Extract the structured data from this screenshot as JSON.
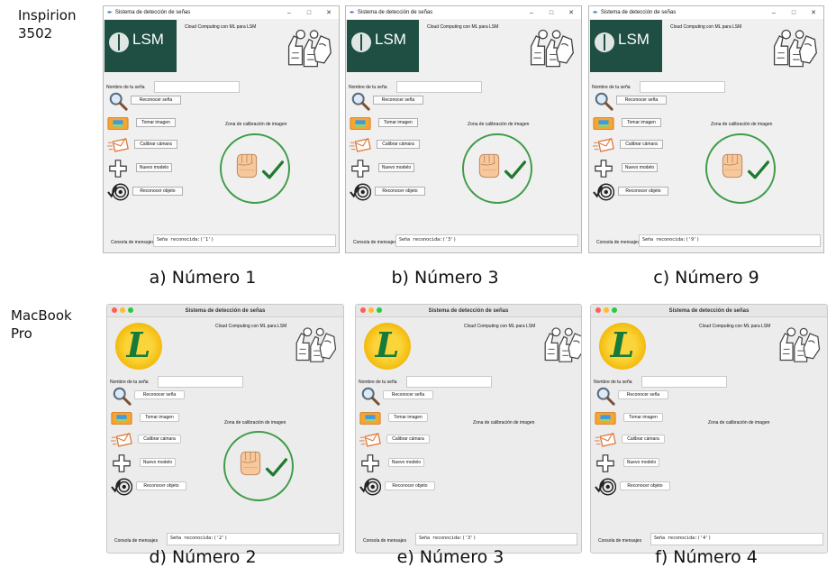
{
  "rows": [
    {
      "label": "Inspirion\n3502"
    },
    {
      "label": "MacBook\nPro"
    }
  ],
  "app": {
    "window_title": "Sistema de detección de señas",
    "subtitle": "Cloud Computing con ML para LSM",
    "lsm_logo_text": "LSM",
    "sign_name_label": "Nombre de tu seña",
    "sign_name_value": "",
    "buttons": {
      "recognize_sign": "Reconocer seña",
      "take_image": "Tomar imagen",
      "calibrate_camera": "Calibrar cámara",
      "new_model": "Nuevo modelo",
      "recognize_object": "Reconocer objeto"
    },
    "calibration_zone_title": "Zona de calibración de imagen",
    "console_label": "Consola de mensajes"
  },
  "panels": [
    {
      "caption": "a) Número 1",
      "console": "Seña reconocida:('1')",
      "logo": "lsm",
      "show_zone": true
    },
    {
      "caption": "b) Número 3",
      "console": "Seña reconocida:('3')",
      "logo": "lsm",
      "show_zone": true
    },
    {
      "caption": "c) Número 9",
      "console": "Seña reconocida:('9')",
      "logo": "lsm",
      "show_zone": true
    },
    {
      "caption": "d) Número 2",
      "console": "Seña reconocida:('2')",
      "logo": "leaf",
      "show_zone": true
    },
    {
      "caption": "e) Número 3",
      "console": "Seña reconocida:('3')",
      "logo": "leaf",
      "show_zone": false
    },
    {
      "caption": "f) Número 4",
      "console": "Seña reconocida:('4')",
      "logo": "leaf",
      "show_zone": false
    }
  ],
  "icons": [
    "search-icon",
    "image-icon",
    "envelope-icon",
    "plus-icon",
    "target-icon",
    "fist-icon",
    "checkmark-icon",
    "hand-signs-icon",
    "brain-icon",
    "leaf-wreath-icon"
  ],
  "colors": {
    "lsm_logo_bg": "#1f4f43",
    "zone_ring": "#3f9c48",
    "check": "#1f7a2e",
    "leaf_logo": "#f2b705",
    "leaf_letter": "#167a3a"
  }
}
